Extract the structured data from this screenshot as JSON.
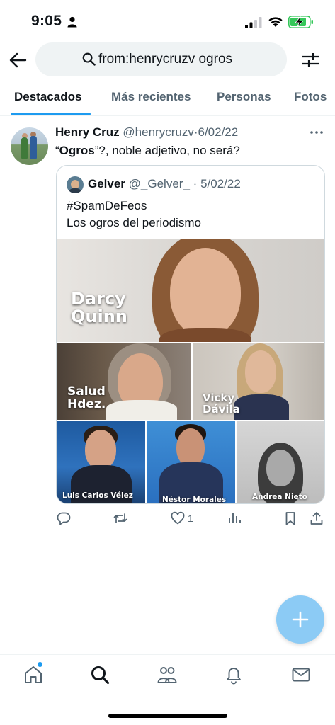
{
  "status_bar": {
    "time": "9:05",
    "battery_color": "#34c759"
  },
  "search": {
    "query": "from:henrycruzv ogros"
  },
  "tabs": [
    {
      "label": "Destacados",
      "active": true
    },
    {
      "label": "Más recientes"
    },
    {
      "label": "Personas"
    },
    {
      "label": "Fotos"
    }
  ],
  "tweet": {
    "name": "Henry Cruz",
    "handle": "@henrycruzv",
    "separator": "·",
    "date": "6/02/22",
    "text_open": "“",
    "text_bold": "Ogros",
    "text_rest": "”?, noble adjetivo, no será?",
    "quote": {
      "name": "Gelver",
      "handle": "@_Gelver_",
      "separator": "·",
      "date": "5/02/22",
      "line1": "#SpamDeFeos",
      "line2": "Los ogros del periodismo",
      "image_labels": {
        "darcy": [
          "Darcy",
          "Quinn"
        ],
        "salud": [
          "Salud",
          "Hdez."
        ],
        "vicky": [
          "Vicky",
          "Dávila"
        ],
        "luis": "Luis Carlos Vélez",
        "nestor": "Néstor Morales",
        "andrea": "Andrea Nieto"
      }
    },
    "like_count": "1"
  },
  "colors": {
    "accent": "#1d9bf0",
    "fab": "#8ccbf5",
    "secondary_text": "#536471"
  },
  "icons": {
    "back": "arrow-left-icon",
    "search": "search-icon",
    "filter": "sliders-icon",
    "reply": "reply-icon",
    "retweet": "retweet-icon",
    "like": "heart-icon",
    "views": "analytics-icon",
    "bookmark": "bookmark-icon",
    "share": "share-icon",
    "compose": "plus-icon",
    "home": "home-icon",
    "explore": "search-icon",
    "communities": "people-icon",
    "notifications": "bell-icon",
    "messages": "mail-icon"
  }
}
